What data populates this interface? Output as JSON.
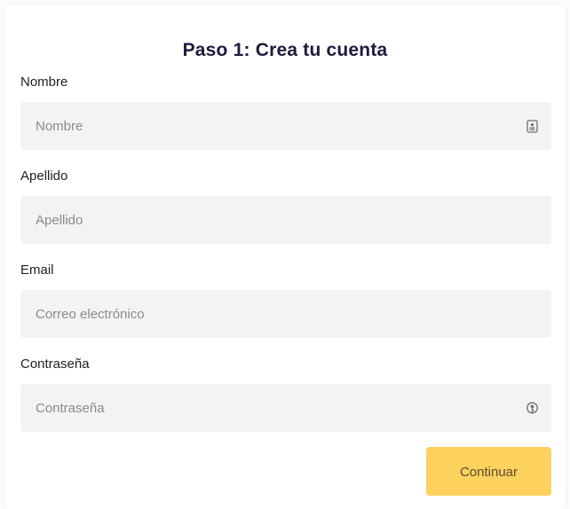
{
  "form": {
    "title": "Paso 1: Crea tu cuenta",
    "fields": [
      {
        "label": "Nombre",
        "placeholder": "Nombre",
        "value": "",
        "icon": "contact-card-icon"
      },
      {
        "label": "Apellido",
        "placeholder": "Apellido",
        "value": ""
      },
      {
        "label": "Email",
        "placeholder": "Correo electrónico",
        "value": ""
      },
      {
        "label": "Contraseña",
        "placeholder": "Contraseña",
        "value": "",
        "icon": "password-key-icon"
      }
    ],
    "continue_label": "Continuar",
    "colors": {
      "accent": "#fdd15e",
      "title": "#1d1b3d",
      "field_background": "#f3f3f3"
    }
  }
}
